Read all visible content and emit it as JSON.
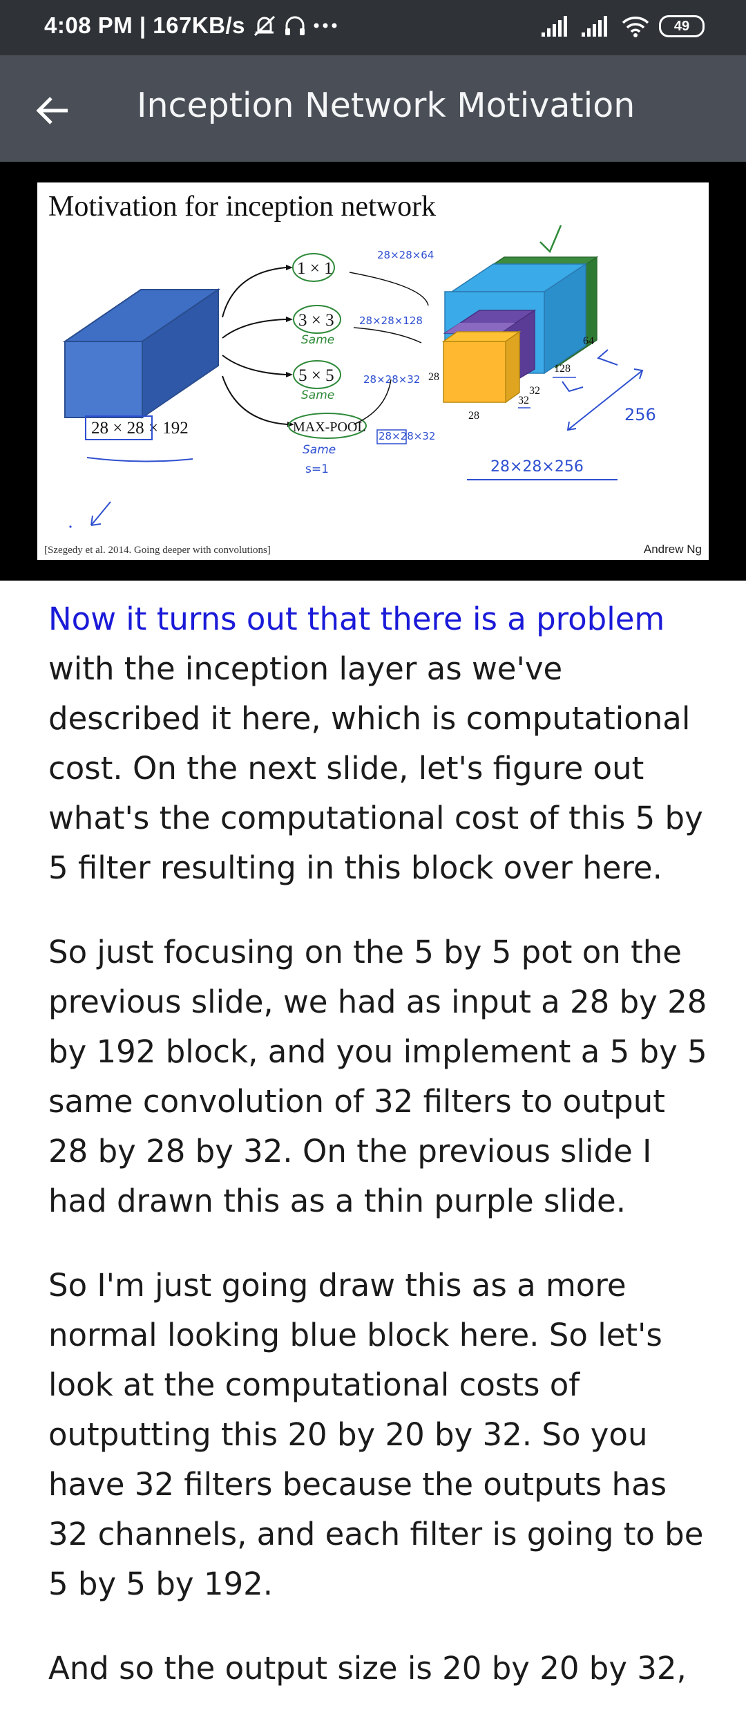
{
  "status_bar": {
    "time_speed": "4:08 PM | 167KB/s",
    "battery": "49"
  },
  "app_bar": {
    "title": "Inception Network Motivation"
  },
  "slide": {
    "title": "Motivation for inception network",
    "input_label": "28 × 28 × 192",
    "filter_1": "1 × 1",
    "filter_3": "3 × 3",
    "filter_5": "5 × 5",
    "pool": "MAX-POOL",
    "dim_28_side": "28",
    "dim_28_bottom": "28",
    "dim_32_a": "32",
    "dim_32_b": "32",
    "dim_64": "64",
    "dim_128": "128",
    "note_1": "28×28×64",
    "note_3": "28×28×128",
    "note_5": "28×28×32",
    "note_pool": "28×28×32",
    "note_same_3": "Same",
    "note_same_5": "Same",
    "note_same_pool": "Same",
    "note_s1": "s=1",
    "note_256": "256",
    "note_output": "28×28×256",
    "citation": "[Szegedy et al. 2014. Going deeper with convolutions]",
    "author": "Andrew Ng"
  },
  "transcript": {
    "p1_highlight": "Now it turns out that there is a problem",
    "p1_rest": " with the inception layer as we've described it here, which is computational cost. On the next slide, let's figure out what's the computational cost of this 5 by 5 filter resulting in this block over here.",
    "p2": "So just focusing on the 5 by 5 pot on the previous slide, we had as input a 28 by 28 by 192 block, and you implement a 5 by 5 same convolution of 32 filters to output 28 by 28 by 32. On the previous slide I had drawn this as a thin purple slide.",
    "p3": "So I'm just going draw this as a more normal looking blue block here. So let's look at the computational costs of outputting this 20 by 20 by 32. So you have 32 filters because the outputs has 32 channels, and each filter is going to be 5 by 5 by 192.",
    "p4": "And so the output size is 20 by 20 by 32,"
  },
  "colors": {
    "status_bg": "#2f3338",
    "appbar_bg": "#4a4f57",
    "highlight_text": "#1a1ad8",
    "annotation_blue": "#2e4fd0",
    "annotation_green": "#2f8a3a"
  }
}
